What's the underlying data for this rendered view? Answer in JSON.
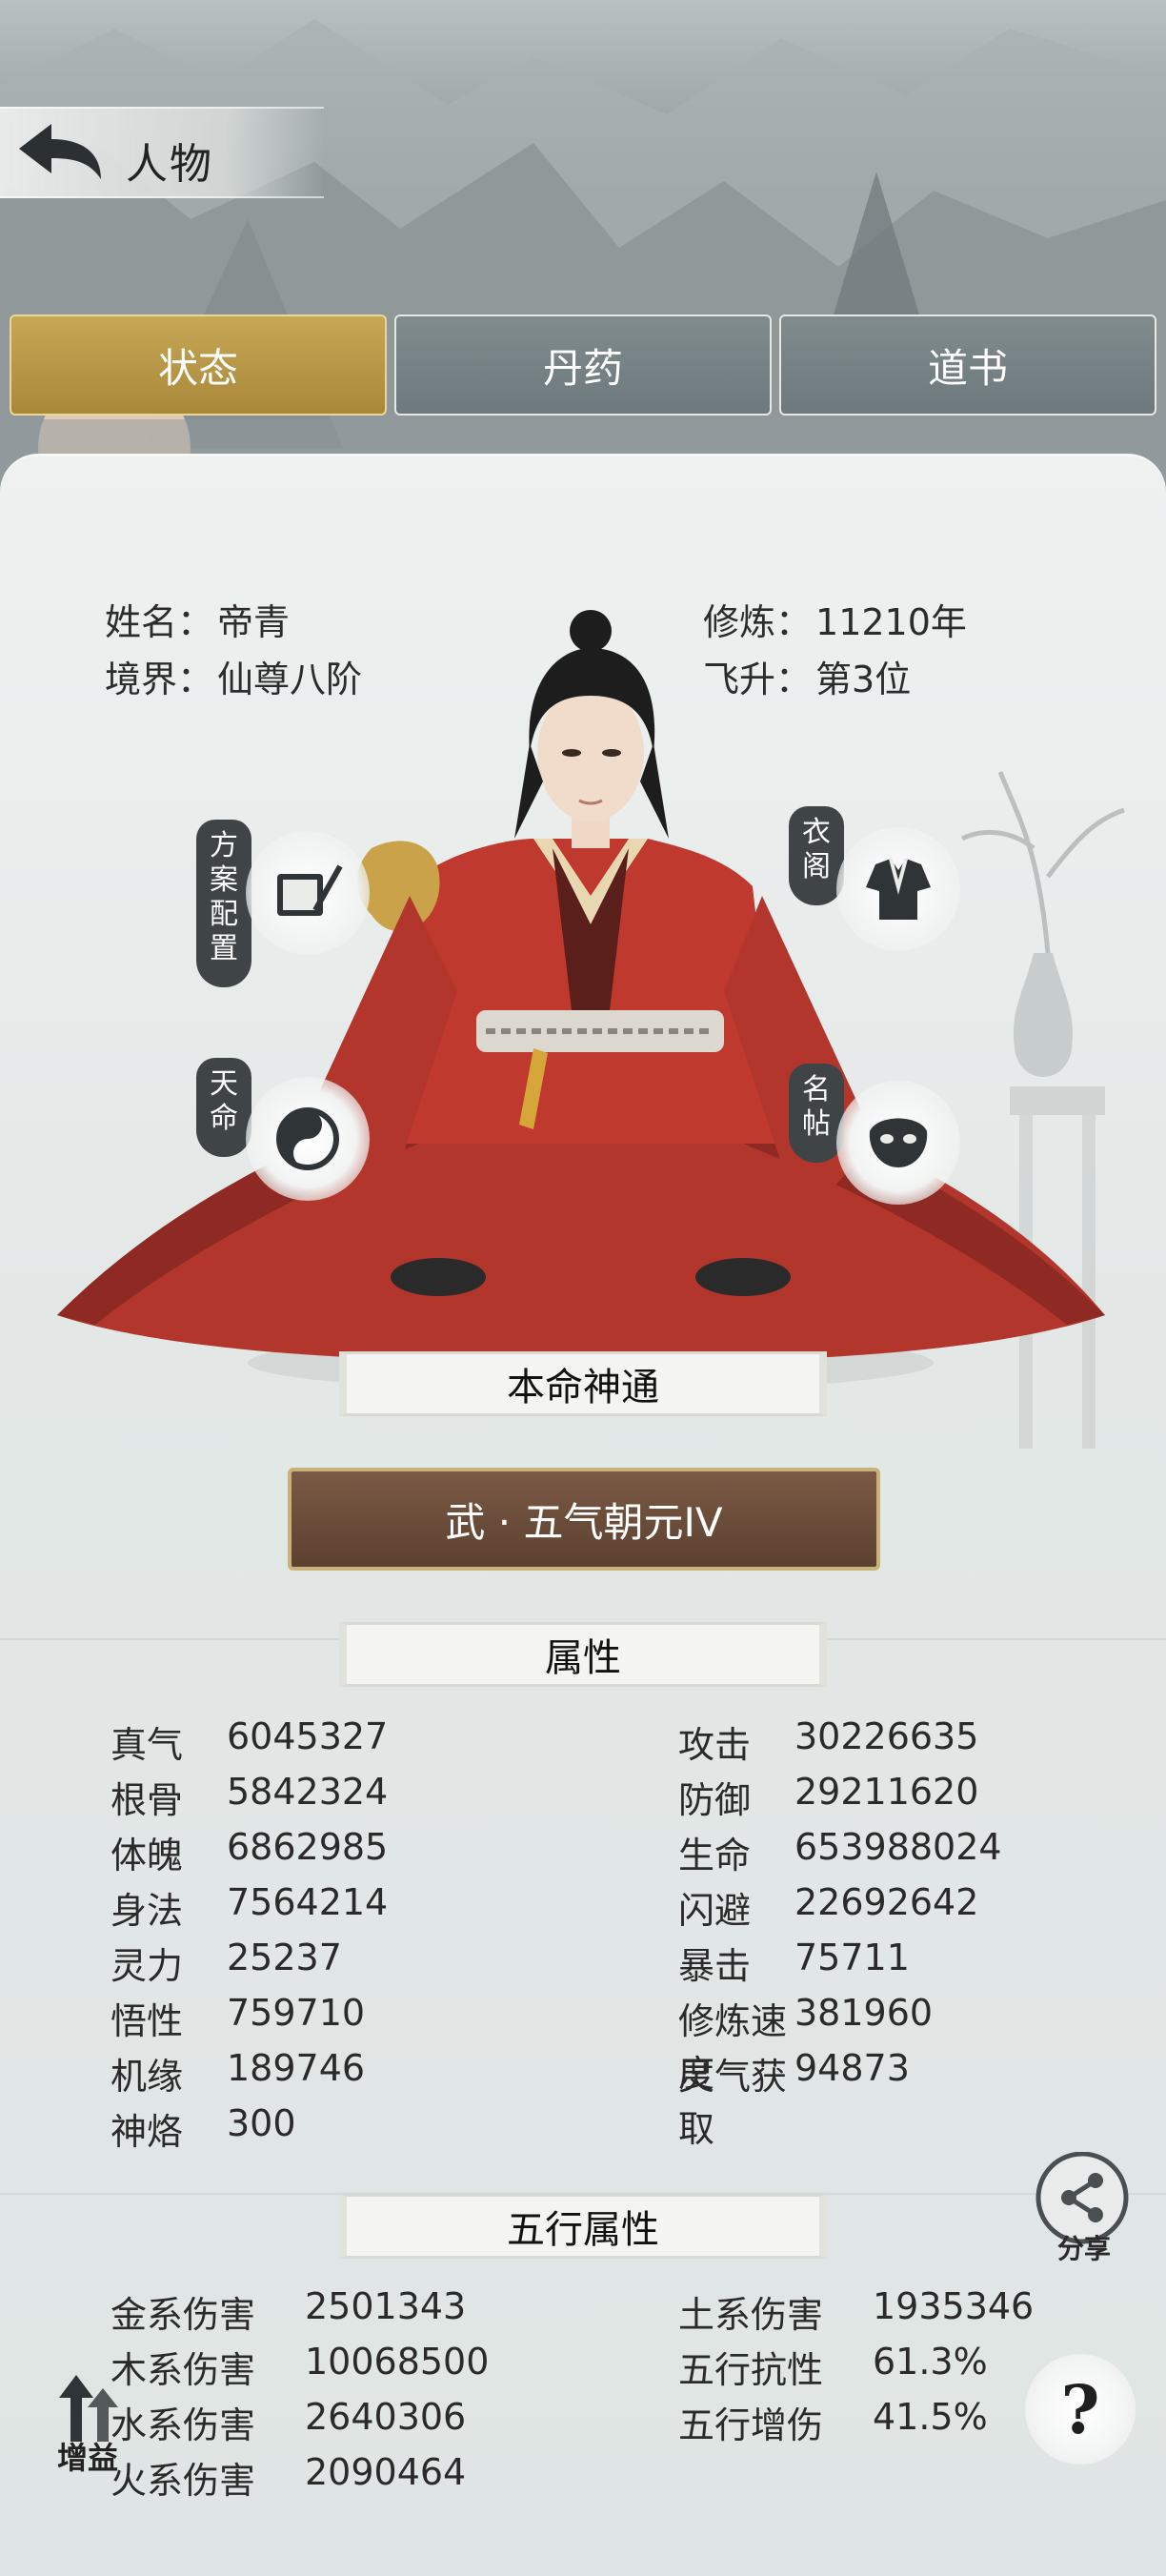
{
  "header": {
    "title": "人物"
  },
  "tabs": [
    {
      "label": "状态",
      "active": true
    },
    {
      "label": "丹药",
      "active": false
    },
    {
      "label": "道书",
      "active": false
    }
  ],
  "info": {
    "name_label": "姓名：",
    "name_value": "帝青",
    "realm_label": "境界：",
    "realm_value": "仙尊八阶",
    "cultivate_label": "修炼：",
    "cultivate_value": "11210年",
    "ascend_label": "飞升：",
    "ascend_value": "第3位"
  },
  "side_buttons": {
    "plan": "方案配置",
    "wardrobe": "衣阁",
    "fate": "天命",
    "card": "名帖"
  },
  "ben_ming": {
    "title": "本命神通",
    "skill": "武 · 五气朝元IV"
  },
  "attributes": {
    "title": "属性",
    "left": [
      {
        "k": "真气",
        "v": "6045327"
      },
      {
        "k": "根骨",
        "v": "5842324"
      },
      {
        "k": "体魄",
        "v": "6862985"
      },
      {
        "k": "身法",
        "v": "7564214"
      },
      {
        "k": "灵力",
        "v": "25237"
      },
      {
        "k": "悟性",
        "v": "759710"
      },
      {
        "k": "机缘",
        "v": "189746"
      },
      {
        "k": "神烙",
        "v": "300"
      }
    ],
    "right": [
      {
        "k": "攻击",
        "v": "30226635"
      },
      {
        "k": "防御",
        "v": "29211620"
      },
      {
        "k": "生命",
        "v": "653988024"
      },
      {
        "k": "闪避",
        "v": "22692642"
      },
      {
        "k": "暴击",
        "v": "75711"
      },
      {
        "k": "修炼速度",
        "v": "381960"
      },
      {
        "k": "灵气获取",
        "v": "94873"
      }
    ]
  },
  "elements": {
    "title": "五行属性",
    "left": [
      {
        "k": "金系伤害",
        "v": "2501343"
      },
      {
        "k": "木系伤害",
        "v": "10068500"
      },
      {
        "k": "水系伤害",
        "v": "2640306"
      },
      {
        "k": "火系伤害",
        "v": "2090464"
      }
    ],
    "right": [
      {
        "k": "土系伤害",
        "v": "1935346"
      },
      {
        "k": "五行抗性",
        "v": "61.3%"
      },
      {
        "k": "五行增伤",
        "v": "41.5%"
      }
    ]
  },
  "float_buttons": {
    "share": "分享",
    "buff": "增益",
    "help": "?"
  },
  "colors": {
    "active_tab": "#b8973f",
    "inactive_tab": "#76838a",
    "skill_bg": "#6a4a38",
    "robe": "#b3362c"
  }
}
